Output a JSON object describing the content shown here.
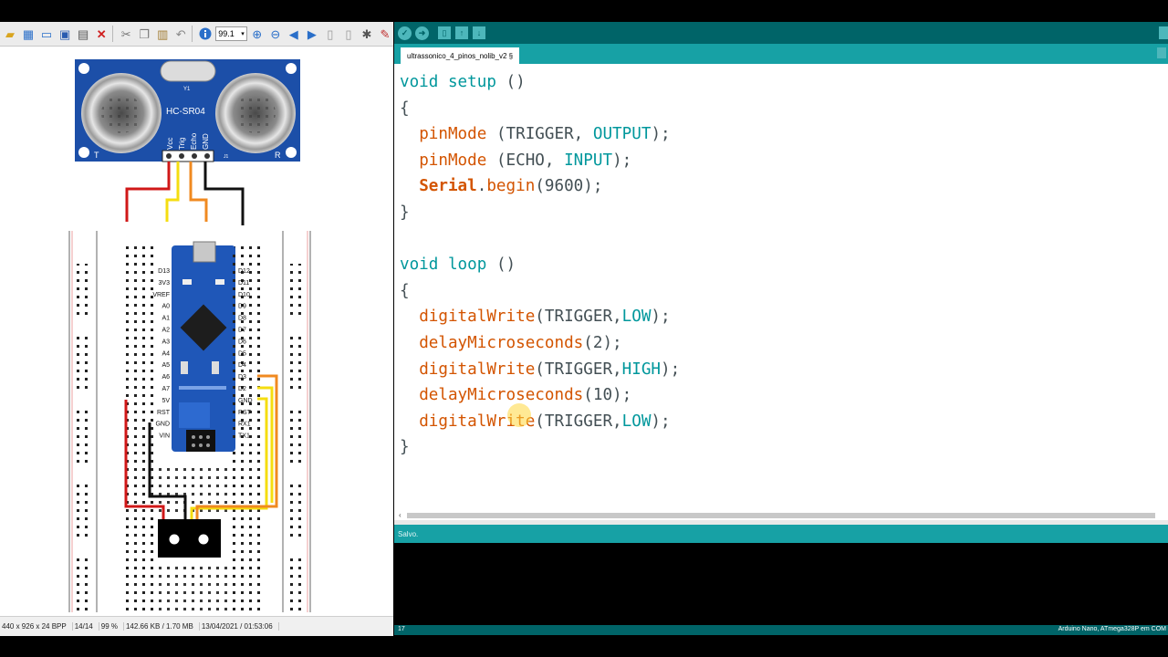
{
  "viewer": {
    "zoom_value": "99.1",
    "status": {
      "dimensions": "440 x 926 x 24 BPP",
      "index": "14/14",
      "zoom": "99 %",
      "size": "142.66 KB / 1.70 MB",
      "datetime": "13/04/2021 / 01:53:06"
    },
    "figure": {
      "sensor_label": "HC-SR04",
      "crystal_label": "Y1",
      "t_label": "T",
      "r_label": "R",
      "j1_label": "J1",
      "pin_vcc": "Vcc",
      "pin_trig": "Trig",
      "pin_echo": "Echo",
      "pin_gnd": "GND",
      "nano_left_pins": [
        "D13",
        "3V3",
        "VREF",
        "A0",
        "A1",
        "A2",
        "A3",
        "A4",
        "A5",
        "A6",
        "A7",
        "5V",
        "RST",
        "GND",
        "VIN"
      ],
      "nano_right_pins": [
        "D12",
        "D11",
        "D10",
        "D9",
        "D8",
        "D7",
        "D6",
        "D5",
        "D4",
        "D3",
        "D2",
        "GND",
        "RST",
        "RX1",
        "TX1"
      ]
    }
  },
  "ide": {
    "tab_label": "ultrassonico_4_pinos_nolib_v2 §",
    "code": {
      "void": "void",
      "setup": "setup",
      "loop": "loop",
      "parens": "()",
      "open_brace": "{",
      "close_brace": "}",
      "pinMode": "pinMode",
      "pin1_args": "(TRIGGER, ",
      "pin2_args": "(ECHO, ",
      "OUTPUT": "OUTPUT",
      "INPUT": "INPUT",
      "Serial": "Serial",
      "begin": "begin",
      "baud": "(9600);",
      "digitalWrite": "digitalWrite",
      "delayMicroseconds": "delayMicroseconds",
      "trigger_args": "(TRIGGER,",
      "LOW": "LOW",
      "HIGH": "HIGH",
      "delay2": "(2);",
      "delay10": "(10);",
      "close_stmt": ");"
    },
    "status_text": "Salvo.",
    "line_number": "17",
    "board": "Arduino Nano, ATmega328P em COM"
  }
}
